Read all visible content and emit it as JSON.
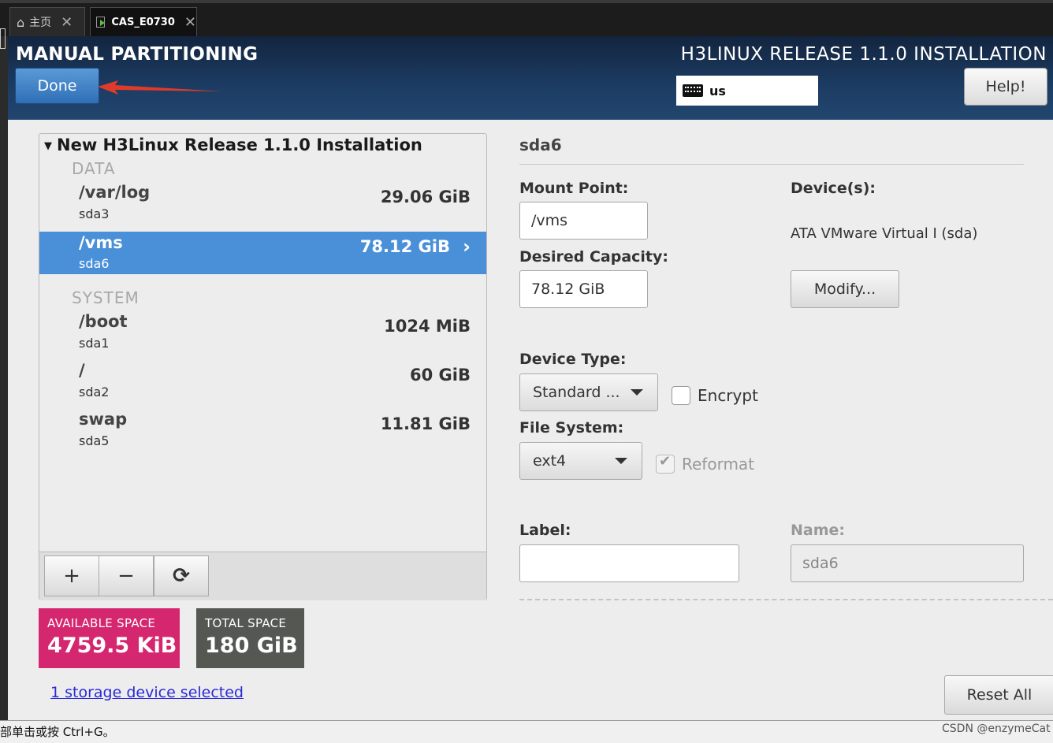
{
  "vm_tabs": [
    {
      "label": "主页",
      "icon": "home-icon"
    },
    {
      "label": "CAS_E0730",
      "icon": "vm-icon"
    }
  ],
  "header": {
    "title": "MANUAL PARTITIONING",
    "product": "H3LINUX RELEASE 1.1.0 INSTALLATION",
    "done_label": "Done",
    "keyboard_layout": "us",
    "help_label": "Help!"
  },
  "tree": {
    "root_label": "New H3Linux Release 1.1.0 Installation",
    "groups": [
      {
        "label": "DATA",
        "items": [
          {
            "mount": "/var/log",
            "device": "sda3",
            "size": "29.06 GiB"
          },
          {
            "mount": "/vms",
            "device": "sda6",
            "size": "78.12 GiB"
          }
        ]
      },
      {
        "label": "SYSTEM",
        "items": [
          {
            "mount": "/boot",
            "device": "sda1",
            "size": "1024 MiB"
          },
          {
            "mount": "/",
            "device": "sda2",
            "size": "60 GiB"
          },
          {
            "mount": "swap",
            "device": "sda5",
            "size": "11.81 GiB"
          }
        ]
      }
    ],
    "toolbar": {
      "add": "+",
      "remove": "−",
      "refresh": "⟳"
    }
  },
  "space": {
    "available_label": "AVAILABLE SPACE",
    "available_value": "4759.5 KiB",
    "total_label": "TOTAL SPACE",
    "total_value": "180 GiB"
  },
  "storage_link": "1 storage device selected",
  "detail": {
    "name": "sda6",
    "mount_point_label": "Mount Point:",
    "mount_point_value": "/vms",
    "capacity_label": "Desired Capacity:",
    "capacity_value": "78.12 GiB",
    "devices_label": "Device(s):",
    "devices_value": "ATA VMware Virtual I (sda)",
    "modify_label": "Modify...",
    "device_type_label": "Device Type:",
    "device_type_value": "Standard ...",
    "encrypt_label": "Encrypt",
    "fs_label": "File System:",
    "fs_value": "ext4",
    "reformat_label": "Reformat",
    "label_label": "Label:",
    "label_value": "",
    "name_label": "Name:",
    "name_value": "sda6",
    "reset_label": "Reset All"
  },
  "statusbar": {
    "text": "部单击或按 Ctrl+G。",
    "watermark": "CSDN @enzymeCat"
  },
  "colors": {
    "accent": "#4a90d9",
    "available": "#d5276f",
    "total": "#555753",
    "header": "#1c3c63"
  }
}
